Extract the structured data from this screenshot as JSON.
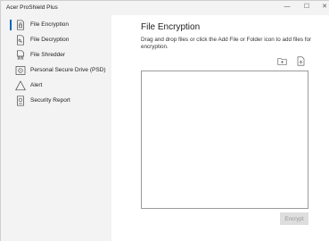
{
  "app": {
    "title": "Acer ProShield Plus",
    "controls": {
      "minimize": "—",
      "maximize": "☐",
      "close": "✕"
    }
  },
  "sidebar": {
    "items": [
      {
        "label": "File Encryption",
        "icon": "file-lock-icon",
        "selected": true
      },
      {
        "label": "File Decryption",
        "icon": "file-key-icon",
        "selected": false
      },
      {
        "label": "File Shredder",
        "icon": "file-shred-icon",
        "selected": false
      },
      {
        "label": "Personal Secure Drive (PSD)",
        "icon": "secure-drive-icon",
        "selected": false
      },
      {
        "label": "Alert",
        "icon": "warning-icon",
        "selected": false
      },
      {
        "label": "Security Report",
        "icon": "report-icon",
        "selected": false
      }
    ]
  },
  "main": {
    "title": "File Encryption",
    "description": "Drag and drop files or click the Add File or Folder icon to add files for encryption.",
    "add_folder_icon": "add-folder-icon",
    "add_file_icon": "add-file-icon",
    "encrypt_label": "Encrypt",
    "encrypt_enabled": false
  },
  "colors": {
    "accent": "#0067c0",
    "sidebar_bg": "#f3f3f3",
    "content_bg": "#ffffff",
    "disabled_button_bg": "#dedede",
    "disabled_button_text": "#9a9a9a"
  }
}
